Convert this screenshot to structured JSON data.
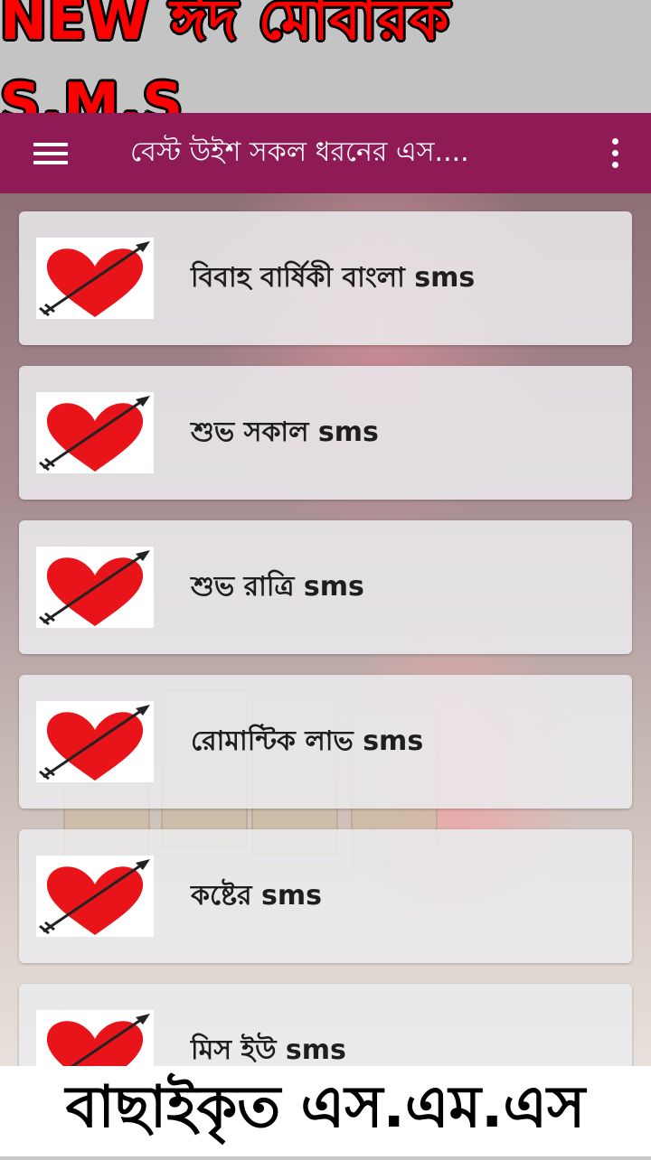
{
  "banner": {
    "top_text": "NEW ঈদ মোবারক S.M.S",
    "bottom_text": "বাছাইকৃত এস.এম.এস"
  },
  "toolbar": {
    "title": "বেস্ট উইশ সকল ধরনের এস....",
    "menu_icon": "hamburger-menu-icon",
    "overflow_icon": "more-vert-icon"
  },
  "colors": {
    "app_bar": "#8e1a56",
    "banner_text": "#ff0000",
    "heart": "#e8141a"
  },
  "list": {
    "thumbnail_icon": "heart-arrow-icon",
    "items": [
      {
        "label": "বিবাহ বার্ষিকী বাংলা sms"
      },
      {
        "label": "শুভ সকাল sms"
      },
      {
        "label": "শুভ রাত্রি sms"
      },
      {
        "label": "রোমান্টিক লাভ sms"
      },
      {
        "label": "কষ্টের sms"
      },
      {
        "label": "মিস ইউ sms"
      }
    ]
  }
}
